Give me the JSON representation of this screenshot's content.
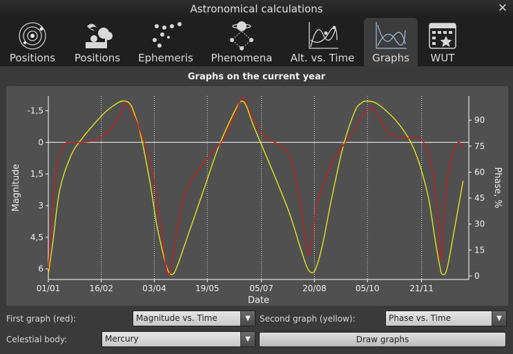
{
  "window": {
    "title": "Astronomical calculations"
  },
  "tabs": [
    {
      "label": "Positions",
      "icon": "solar-system-icon",
      "active": false
    },
    {
      "label": "Positions",
      "icon": "deep-sky-tree-icon",
      "active": false
    },
    {
      "label": "Ephemeris",
      "icon": "ephemeris-dots-icon",
      "active": false
    },
    {
      "label": "Phenomena",
      "icon": "planet-conjunction-icon",
      "active": false
    },
    {
      "label": "Alt. vs. Time",
      "icon": "altitude-curve-icon",
      "active": false
    },
    {
      "label": "Graphs",
      "icon": "graphs-icon",
      "active": true
    },
    {
      "label": "WUT",
      "icon": "calendar-star-icon",
      "active": false
    }
  ],
  "graph": {
    "title": "Graphs on the current year"
  },
  "controls": {
    "first_graph_label": "First graph (red):",
    "first_graph_value": "Magnitude vs. Time",
    "second_graph_label": "Second graph (yellow):",
    "second_graph_value": "Phase vs. Time",
    "celestial_body_label": "Celestial body:",
    "celestial_body_value": "Mercury",
    "draw_button": "Draw graphs"
  },
  "colors": {
    "red_series": "#c81e1e",
    "yellow_series": "#e6e61e",
    "plot_bg": "#505050",
    "axes": "#ffffff"
  },
  "chart_data": {
    "type": "line",
    "xlabel": "Date",
    "x_ticks": [
      "01/01",
      "16/02",
      "03/04",
      "19/05",
      "05/07",
      "20/08",
      "05/10",
      "21/11"
    ],
    "x_tick_days": [
      0,
      46,
      92,
      138,
      185,
      231,
      277,
      324
    ],
    "xlim": [
      0,
      365
    ],
    "ylabel_left": "Magnitude",
    "ylim_left": [
      6.5,
      -2.2
    ],
    "y_ticks_left": [
      "-1,5",
      "0",
      "1,5",
      "3",
      "4,5",
      "6"
    ],
    "y_tick_values_left": [
      -1.5,
      0,
      1.5,
      3,
      4.5,
      6
    ],
    "ylabel_right": "Phase, %",
    "ylim_right": [
      -2,
      104
    ],
    "y_ticks_right": [
      "0",
      "15",
      "30",
      "45",
      "60",
      "75",
      "90"
    ],
    "y_tick_values_right": [
      0,
      15,
      30,
      45,
      60,
      75,
      90
    ],
    "grid": "vertical-dotted",
    "reference_line_left": 0,
    "series": [
      {
        "color": "red",
        "axis": "left",
        "points": [
          [
            0,
            6.0
          ],
          [
            3,
            3.5
          ],
          [
            8,
            1.0
          ],
          [
            14,
            0.1
          ],
          [
            20,
            0.0
          ],
          [
            30,
            0.0
          ],
          [
            40,
            -0.1
          ],
          [
            50,
            -0.4
          ],
          [
            60,
            -1.1
          ],
          [
            66,
            -1.8
          ],
          [
            70,
            -1.7
          ],
          [
            75,
            -1.2
          ],
          [
            82,
            -0.2
          ],
          [
            88,
            0.8
          ],
          [
            94,
            2.5
          ],
          [
            100,
            5.0
          ],
          [
            104,
            6.3
          ],
          [
            108,
            5.5
          ],
          [
            114,
            3.5
          ],
          [
            122,
            2.0
          ],
          [
            132,
            1.2
          ],
          [
            142,
            0.5
          ],
          [
            150,
            0.0
          ],
          [
            158,
            -0.8
          ],
          [
            164,
            -1.6
          ],
          [
            168,
            -2.1
          ],
          [
            172,
            -1.9
          ],
          [
            176,
            -1.3
          ],
          [
            182,
            -0.7
          ],
          [
            190,
            -0.2
          ],
          [
            200,
            0.1
          ],
          [
            208,
            0.5
          ],
          [
            214,
            1.5
          ],
          [
            219,
            3.0
          ],
          [
            223,
            4.5
          ],
          [
            226,
            5.4
          ],
          [
            229,
            4.5
          ],
          [
            233,
            3.0
          ],
          [
            240,
            1.8
          ],
          [
            248,
            0.8
          ],
          [
            258,
            0.0
          ],
          [
            266,
            -0.6
          ],
          [
            272,
            -1.2
          ],
          [
            278,
            -1.6
          ],
          [
            282,
            -1.6
          ],
          [
            288,
            -1.1
          ],
          [
            296,
            -0.4
          ],
          [
            310,
            -0.2
          ],
          [
            320,
            -0.2
          ],
          [
            328,
            0.2
          ],
          [
            334,
            1.6
          ],
          [
            338,
            3.5
          ],
          [
            341,
            5.6
          ],
          [
            343,
            3.8
          ],
          [
            347,
            1.5
          ],
          [
            352,
            0.4
          ],
          [
            356,
            0.0
          ],
          [
            360,
            0.2
          ]
        ]
      },
      {
        "color": "yellow",
        "axis": "right",
        "points": [
          [
            0,
            1
          ],
          [
            4,
            20
          ],
          [
            10,
            50
          ],
          [
            20,
            70
          ],
          [
            30,
            80
          ],
          [
            40,
            88
          ],
          [
            50,
            95
          ],
          [
            58,
            99
          ],
          [
            64,
            101
          ],
          [
            70,
            100
          ],
          [
            74,
            95
          ],
          [
            80,
            82
          ],
          [
            88,
            55
          ],
          [
            94,
            30
          ],
          [
            100,
            12
          ],
          [
            104,
            3
          ],
          [
            108,
            1
          ],
          [
            112,
            6
          ],
          [
            122,
            25
          ],
          [
            135,
            50
          ],
          [
            148,
            75
          ],
          [
            158,
            90
          ],
          [
            164,
            98
          ],
          [
            168,
            101
          ],
          [
            172,
            98
          ],
          [
            178,
            87
          ],
          [
            190,
            68
          ],
          [
            200,
            52
          ],
          [
            210,
            35
          ],
          [
            218,
            18
          ],
          [
            224,
            6
          ],
          [
            228,
            2
          ],
          [
            232,
            4
          ],
          [
            238,
            18
          ],
          [
            246,
            45
          ],
          [
            256,
            75
          ],
          [
            266,
            95
          ],
          [
            272,
            100
          ],
          [
            276,
            101
          ],
          [
            284,
            100
          ],
          [
            294,
            95
          ],
          [
            304,
            88
          ],
          [
            314,
            78
          ],
          [
            322,
            65
          ],
          [
            330,
            45
          ],
          [
            336,
            20
          ],
          [
            340,
            5
          ],
          [
            342,
            1
          ],
          [
            346,
            4
          ],
          [
            352,
            25
          ],
          [
            360,
            55
          ]
        ]
      }
    ]
  }
}
